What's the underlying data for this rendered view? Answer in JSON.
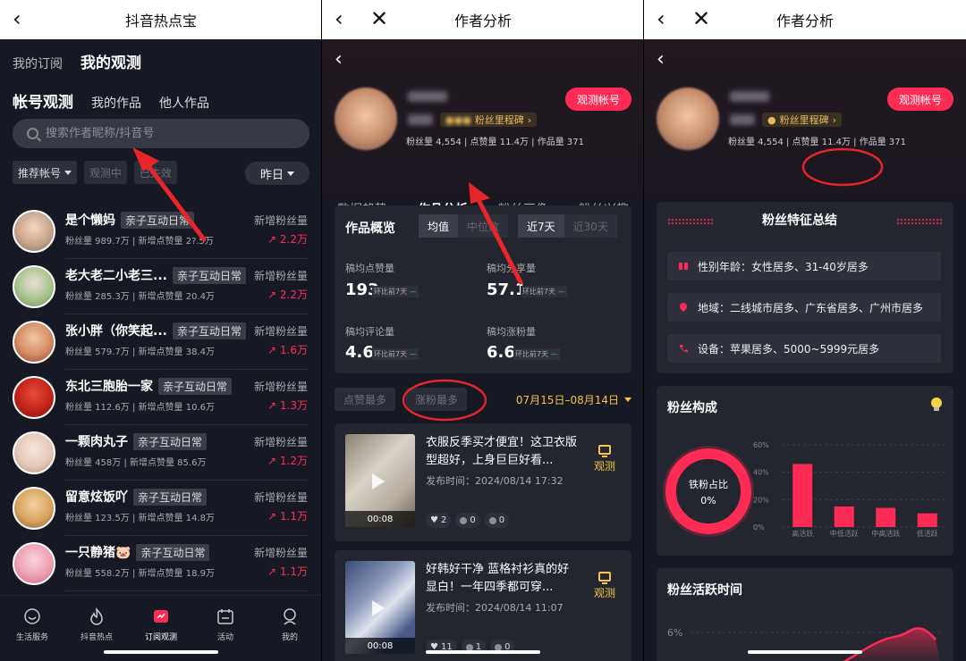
{
  "panel1": {
    "title": "抖音热点宝",
    "top_tabs": [
      "我的订阅",
      "我的观测"
    ],
    "sub_tabs": [
      "帐号观测",
      "我的作品",
      "他人作品"
    ],
    "search_placeholder": "搜索作者昵称/抖音号",
    "filters": [
      "推荐帐号",
      "观测中",
      "已失效"
    ],
    "day_filter": "昨日",
    "accounts": [
      {
        "name": "是个懒妈",
        "tag": "亲子互动日常",
        "stats": "粉丝量 989.7万 | 新增点赞量 2?.5万",
        "gain_label": "新增粉丝量",
        "gain": "↗ 2.2万"
      },
      {
        "name": "老大老二小老三...",
        "tag": "亲子互动日常",
        "stats": "粉丝量 285.3万 | 新增点赞量 20.4万",
        "gain_label": "新增粉丝量",
        "gain": "↗ 2.2万"
      },
      {
        "name": "张小胖（你笑起...",
        "tag": "亲子互动日常",
        "stats": "粉丝量 579.7万 | 新增点赞量 38.4万",
        "gain_label": "新增粉丝量",
        "gain": "↗ 1.6万"
      },
      {
        "name": "东北三胞胎一家",
        "tag": "亲子互动日常",
        "stats": "粉丝量 112.6万 | 新增点赞量 10.6万",
        "gain_label": "新增粉丝量",
        "gain": "↗ 1.3万"
      },
      {
        "name": "一颗肉丸子",
        "tag": "亲子互动日常",
        "stats": "粉丝量 458万 | 新增点赞量 85.6万",
        "gain_label": "新增粉丝量",
        "gain": "↗ 1.2万"
      },
      {
        "name": "留意炫饭吖",
        "tag": "亲子互动日常",
        "stats": "粉丝量 123.5万 | 新增点赞量 14.8万",
        "gain_label": "新增粉丝量",
        "gain": "↗ 1.1万"
      },
      {
        "name": "一只静猪🐷",
        "tag": "亲子互动日常",
        "stats": "粉丝量 558.2万 | 新增点赞量 18.9万",
        "gain_label": "新增粉丝量",
        "gain": "↗ 1.1万"
      }
    ],
    "tabbar": [
      "生活服务",
      "抖音热点",
      "订阅观测",
      "活动",
      "我的"
    ]
  },
  "author": {
    "title": "作者分析",
    "badge": "粉丝里程碑",
    "stats": "粉丝量 4,554 | 点赞量 11.4万 | 作品量 371",
    "observe_button": "观测帐号",
    "tabs": [
      "数据趋势",
      "作品分析",
      "粉丝画像",
      "粉丝兴趣"
    ]
  },
  "panel2": {
    "overview_title": "作品概览",
    "mode": [
      "均值",
      "中位数"
    ],
    "range": [
      "近7天",
      "近30天"
    ],
    "metrics": [
      {
        "label": "稿均点赞量",
        "value": "193",
        "compare": "环比前7天"
      },
      {
        "label": "稿均分享量",
        "value": "57.1",
        "compare": "环比前7天"
      },
      {
        "label": "稿均评论量",
        "value": "4.6",
        "compare": "环比前7天"
      },
      {
        "label": "稿均涨粉量",
        "value": "6.6",
        "compare": "环比前7天"
      }
    ],
    "sort": [
      "点赞最多",
      "涨粉最多"
    ],
    "date_range": "07月15日–08月14日",
    "videos": [
      {
        "title": "衣服反季买才便宜！这卫衣版型超好，上身巨巨好看...",
        "time": "发布时间：2024/08/14 17:32",
        "duration": "00:08",
        "observe": "观测",
        "likes": "2",
        "comments": "0",
        "shares": "0"
      },
      {
        "title": "好韩好干净 蓝格衬衫真的好显白！一年四季都可穿...",
        "time": "发布时间：2024/08/14 11:07",
        "duration": "00:08",
        "observe": "观测",
        "likes": "11",
        "comments": "1",
        "shares": "0"
      }
    ]
  },
  "panel3": {
    "summary_title": "粉丝特征总结",
    "traits": [
      "性别年龄：女性居多、31-40岁居多",
      "地域：二线城市居多、广东省居多、广州市居多",
      "设备：苹果居多、5000~5999元居多"
    ],
    "composition_title": "粉丝构成",
    "donut_label": "铁粉占比",
    "donut_value": "0%",
    "active_time_title": "粉丝活跃时间",
    "active_tick": "6%"
  },
  "chart_data": {
    "type": "bar",
    "title": "粉丝构成",
    "categories": [
      "高活跃",
      "中低活跃",
      "中高活跃",
      "低活跃"
    ],
    "values": [
      46,
      15,
      14,
      10
    ],
    "ylim": [
      0,
      60
    ],
    "yticks": [
      "0%",
      "20%",
      "40%",
      "60%"
    ],
    "color": "#fe2c55"
  }
}
